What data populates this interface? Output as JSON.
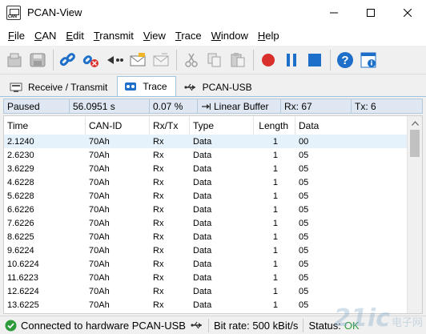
{
  "window": {
    "title": "PCAN-View"
  },
  "menu": [
    {
      "label": "File",
      "u": "F",
      "rest": "ile"
    },
    {
      "label": "CAN",
      "u": "C",
      "rest": "AN"
    },
    {
      "label": "Edit",
      "u": "E",
      "rest": "dit"
    },
    {
      "label": "Transmit",
      "u": "T",
      "rest": "ransmit"
    },
    {
      "label": "View",
      "u": "V",
      "rest": "iew"
    },
    {
      "label": "Trace",
      "u": "T",
      "rest": "race"
    },
    {
      "label": "Window",
      "u": "W",
      "rest": "indow"
    },
    {
      "label": "Help",
      "u": "H",
      "rest": "elp"
    }
  ],
  "toolbar": {
    "icons": [
      "new-icon",
      "save-icon",
      "connect-icon",
      "disconnect-icon",
      "back-icon",
      "message-icon",
      "message-icon",
      "cut-icon",
      "copy-icon",
      "paste-icon",
      "record-icon",
      "pause-icon",
      "stop-icon",
      "help-icon",
      "about-icon"
    ],
    "accent_red": "#d9302c",
    "accent_blue": "#1e6fc9"
  },
  "tabs": [
    {
      "label": "Receive / Transmit",
      "active": false
    },
    {
      "label": "Trace",
      "active": true
    },
    {
      "label": "PCAN-USB",
      "active": false
    }
  ],
  "trace_status": {
    "state": "Paused",
    "duration": "56.0951 s",
    "percent": "0.07 %",
    "buffer": "Linear Buffer",
    "rx": "Rx: 67",
    "tx": "Tx: 6"
  },
  "grid": {
    "columns": [
      "Time",
      "CAN-ID",
      "Rx/Tx",
      "Type",
      "Length",
      "Data"
    ],
    "rows": [
      {
        "time": "2.1240",
        "id": "70Ah",
        "dir": "Rx",
        "type": "Data",
        "len": "1",
        "data": "00"
      },
      {
        "time": "2.6230",
        "id": "70Ah",
        "dir": "Rx",
        "type": "Data",
        "len": "1",
        "data": "05"
      },
      {
        "time": "3.6229",
        "id": "70Ah",
        "dir": "Rx",
        "type": "Data",
        "len": "1",
        "data": "05"
      },
      {
        "time": "4.6228",
        "id": "70Ah",
        "dir": "Rx",
        "type": "Data",
        "len": "1",
        "data": "05"
      },
      {
        "time": "5.6228",
        "id": "70Ah",
        "dir": "Rx",
        "type": "Data",
        "len": "1",
        "data": "05"
      },
      {
        "time": "6.6226",
        "id": "70Ah",
        "dir": "Rx",
        "type": "Data",
        "len": "1",
        "data": "05"
      },
      {
        "time": "7.6226",
        "id": "70Ah",
        "dir": "Rx",
        "type": "Data",
        "len": "1",
        "data": "05"
      },
      {
        "time": "8.6225",
        "id": "70Ah",
        "dir": "Rx",
        "type": "Data",
        "len": "1",
        "data": "05"
      },
      {
        "time": "9.6224",
        "id": "70Ah",
        "dir": "Rx",
        "type": "Data",
        "len": "1",
        "data": "05"
      },
      {
        "time": "10.6224",
        "id": "70Ah",
        "dir": "Rx",
        "type": "Data",
        "len": "1",
        "data": "05"
      },
      {
        "time": "11.6223",
        "id": "70Ah",
        "dir": "Rx",
        "type": "Data",
        "len": "1",
        "data": "05"
      },
      {
        "time": "12.6224",
        "id": "70Ah",
        "dir": "Rx",
        "type": "Data",
        "len": "1",
        "data": "05"
      },
      {
        "time": "13.6225",
        "id": "70Ah",
        "dir": "Rx",
        "type": "Data",
        "len": "1",
        "data": "05"
      }
    ],
    "selected_row": 0
  },
  "statusbar": {
    "connection": "Connected to hardware PCAN-USB",
    "bitrate": "Bit rate: 500 kBit/s",
    "status": "Status:",
    "status_value": "OK",
    "ok_color": "#2e9b3a"
  },
  "watermark": {
    "big": "21ic",
    "small": "电子网"
  }
}
